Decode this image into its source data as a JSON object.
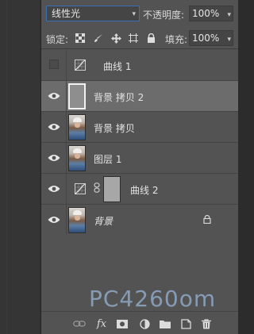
{
  "blend": {
    "mode": "线性光",
    "opacity_label": "不透明度:",
    "opacity_value": "100%"
  },
  "lock": {
    "label": "锁定:",
    "fill_label": "填充:",
    "fill_value": "100%"
  },
  "layers": [
    {
      "name": "曲线 1",
      "visible": false,
      "kind": "adjustment"
    },
    {
      "name": "背景 拷贝 2",
      "visible": true,
      "kind": "pixel",
      "selected": true
    },
    {
      "name": "背景 拷贝",
      "visible": true,
      "kind": "pixel"
    },
    {
      "name": "图层 1",
      "visible": true,
      "kind": "pixel"
    },
    {
      "name": "曲线 2",
      "visible": true,
      "kind": "adjustment-mask"
    },
    {
      "name": "背景",
      "visible": true,
      "kind": "background",
      "locked": true
    }
  ],
  "watermark": "PC4260om",
  "icons": {
    "lock_transparent": "checker-icon",
    "lock_paint": "brush-icon",
    "lock_move": "move-icon",
    "lock_artboard": "artboard-icon",
    "lock_all": "lock-icon",
    "bottom": [
      "link-icon",
      "fx-icon",
      "mask-icon",
      "adjustment-icon",
      "folder-icon",
      "new-layer-icon",
      "trash-icon"
    ]
  },
  "colors": {
    "panel": "#535353",
    "selected": "#6c6c6c",
    "accent": "#3a6fb8"
  }
}
